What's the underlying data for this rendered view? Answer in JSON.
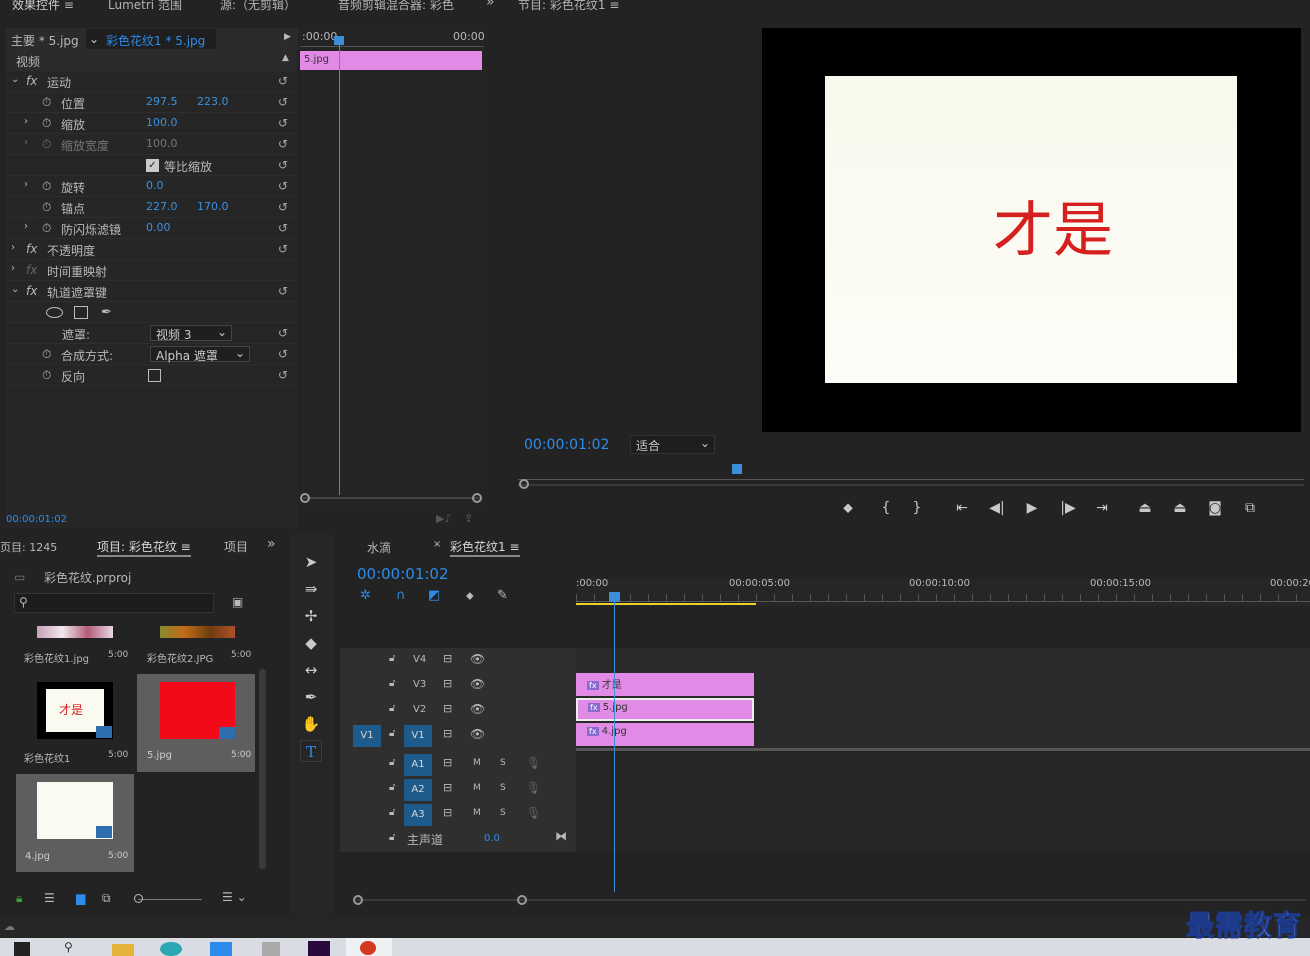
{
  "top_tabs": {
    "effect_controls": "效果控件",
    "lumetri": "Lumetri 范围",
    "source": "源:（无剪辑）",
    "audio_mixer": "音频剪辑混合器: 彩色",
    "program": "节目: 彩色花纹1"
  },
  "ec": {
    "master": "主要 * 5.jpg",
    "sequence": "彩色花纹1 * 5.jpg",
    "video": "视频",
    "motion": "运动",
    "position": "位置",
    "pos_x": "297.5",
    "pos_y": "223.0",
    "scale": "缩放",
    "scale_v": "100.0",
    "scale_w": "缩放宽度",
    "scale_w_v": "100.0",
    "uniform": "等比缩放",
    "rotation": "旋转",
    "rotation_v": "0.0",
    "anchor": "锚点",
    "anchor_x": "227.0",
    "anchor_y": "170.0",
    "flicker": "防闪烁滤镜",
    "flicker_v": "0.00",
    "opacity": "不透明度",
    "timeremap": "时间重映射",
    "trackmatte": "轨道遮罩键",
    "matte": "遮罩:",
    "matte_v": "视频 3",
    "composite": "合成方式:",
    "composite_v": "Alpha 遮罩",
    "reverse": "反向",
    "time": "00:00:01:02",
    "ruler_start": ":00:00",
    "ruler_end": "00:00",
    "clip": "5.jpg",
    "fx": "fx"
  },
  "program": {
    "text": "才是",
    "timecode": "00:00:01:02",
    "fit": "适合"
  },
  "project": {
    "tab_media": "页目: 1245",
    "tab_project": "项目: 彩色花纹",
    "tab_other": "项目",
    "file": "彩色花纹.prproj",
    "items": [
      {
        "name": "彩色花纹1.jpg",
        "dur": "5:00"
      },
      {
        "name": "彩色花纹2.JPG",
        "dur": "5:00"
      },
      {
        "name": "彩色花纹1",
        "dur": "5:00"
      },
      {
        "name": "5.jpg",
        "dur": "5:00"
      },
      {
        "name": "4.jpg",
        "dur": "5:00"
      }
    ],
    "thumb_text": "才是"
  },
  "timeline": {
    "tab1": "水滴",
    "tab2": "彩色花纹1",
    "timecode": "00:00:01:02",
    "ruler": [
      ":00:00",
      "00:00:05:00",
      "00:00:10:00",
      "00:00:15:00",
      "00:00:20"
    ],
    "tracks": [
      "V4",
      "V3",
      "V2",
      "V1",
      "A1",
      "A2",
      "A3"
    ],
    "master": "主声道",
    "master_v": "0.0",
    "clips": [
      "才是",
      "5.jpg",
      "4.jpg"
    ],
    "src": "V1",
    "m": "M",
    "s": "S"
  },
  "watermark": "最需教育"
}
